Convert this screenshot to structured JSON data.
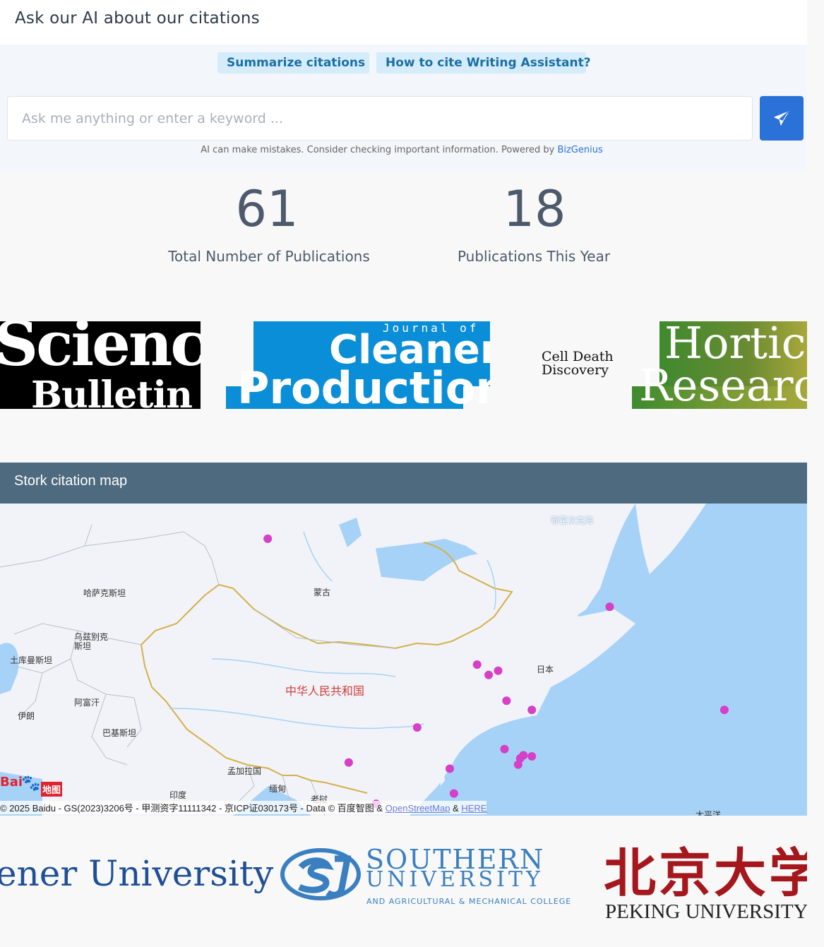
{
  "ai": {
    "title": "Ask our AI about our citations",
    "chips": [
      "Summarize citations",
      "How to cite Writing Assistant?"
    ],
    "search_placeholder": "Ask me anything or enter a keyword ...",
    "disclaimer_text": "AI can make mistakes. Consider checking important information. Powered by ",
    "disclaimer_link": "BizGenius",
    "send_icon": "paper-plane-icon"
  },
  "stats": [
    {
      "value": "61",
      "label": "Total Number of Publications"
    },
    {
      "value": "18",
      "label": "Publications This Year"
    }
  ],
  "journal_logos": {
    "science": [
      "Science",
      "Bulletin"
    ],
    "cleaner": [
      "Journal of",
      "Cleaner",
      "Production"
    ],
    "celldeath": [
      "Cell Death",
      "Discovery"
    ],
    "hort": [
      "Horticu",
      "Researc"
    ]
  },
  "map": {
    "title": "Stork citation map",
    "labels": {
      "kazakhstan": "哈萨克斯坦",
      "mongolia": "蒙古",
      "uzbekistan": "乌兹别克\n斯坦",
      "turkmenistan": "土库曼斯坦",
      "china": "中华人民共和国",
      "afghanistan": "阿富汗",
      "iran": "伊朗",
      "pakistan": "巴基斯坦",
      "bangladesh": "孟加拉国",
      "myanmar": "缅甸",
      "india": "印度",
      "laos": "老挝",
      "japan": "日本",
      "okhotsk": "鄂霍次克海",
      "pacific": "太平洋"
    },
    "baidu_logo": "Bai",
    "baidu_badge": "地图",
    "attribution_text": "© 2025 Baidu - GS(2023)3206号 - 甲测资字11111342 - 京ICP证030173号 - Data © 百度智图 & ",
    "attribution_osm": "OpenStreetMap",
    "attribution_amp": " & ",
    "attribution_here": "HERE",
    "marker_color": "#d63fc7",
    "markers_lonlat": [
      [
        96.3,
        52.3
      ],
      [
        128.8,
        45.7
      ],
      [
        116.2,
        40.1
      ],
      [
        118.2,
        39.5
      ],
      [
        117.3,
        39.1
      ],
      [
        119.0,
        36.6
      ],
      [
        121.4,
        35.7
      ],
      [
        110.5,
        34.0
      ],
      [
        104.0,
        30.6
      ],
      [
        113.6,
        30.0
      ],
      [
        118.8,
        31.9
      ],
      [
        120.1,
        30.4
      ],
      [
        121.4,
        31.2
      ],
      [
        120.6,
        31.3
      ],
      [
        120.3,
        31.0
      ],
      [
        106.6,
        26.6
      ],
      [
        114.0,
        27.6
      ],
      [
        113.2,
        23.1
      ],
      [
        139.7,
        35.7
      ]
    ]
  },
  "universities": {
    "wiener": "ener University",
    "southern": [
      "SOUTHERN",
      "UNIVERSITY",
      "AND AGRICULTURAL & MECHANICAL COLLEGE"
    ],
    "peking_cn": "北京大学",
    "peking_en": "PEKING UNIVERSITY"
  }
}
